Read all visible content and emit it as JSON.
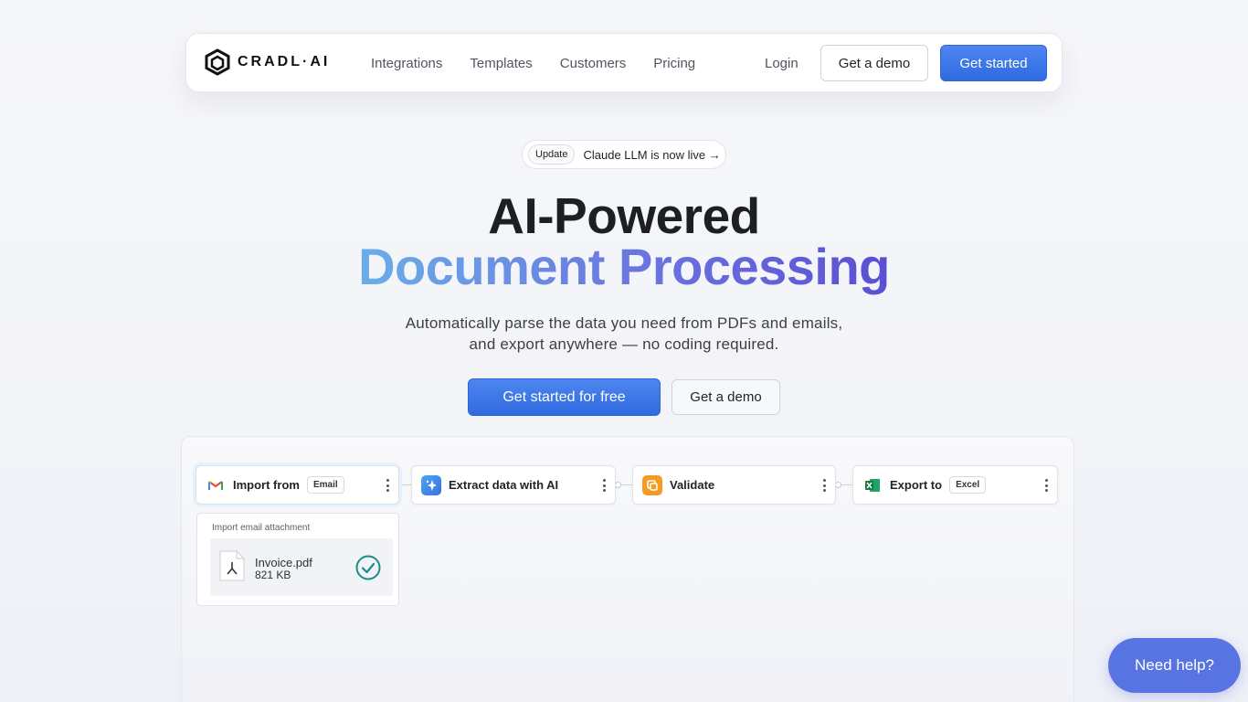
{
  "nav": {
    "logo_text": "CRADL·AI",
    "links": [
      "Integrations",
      "Templates",
      "Customers",
      "Pricing"
    ],
    "login": "Login",
    "demo": "Get a demo",
    "start": "Get started"
  },
  "update": {
    "pill": "Update",
    "text": "Claude LLM is now live →"
  },
  "hero": {
    "line1": "AI-Powered",
    "line2": "Document Processing",
    "sub1": "Automatically parse the data you need from PDFs and emails,",
    "sub2": "and export anywhere — no coding required.",
    "cta_primary": "Get started for free",
    "cta_secondary": "Get a demo"
  },
  "workflow": {
    "nodes": [
      {
        "title": "Import from",
        "chip": "Email",
        "icon": "gmail-icon"
      },
      {
        "title": "Extract data with AI",
        "chip": "",
        "icon": "ai-sparkle-icon"
      },
      {
        "title": "Validate",
        "chip": "",
        "icon": "validate-icon"
      },
      {
        "title": "Export to",
        "chip": "Excel",
        "icon": "excel-icon"
      }
    ],
    "attachment": {
      "label": "Import email attachment",
      "file_name": "Invoice.pdf",
      "file_size": "821 KB"
    }
  },
  "help": "Need help?",
  "colors": {
    "primary": "#2f6ae0",
    "gradient_start": "#6aaee8",
    "gradient_end": "#5b4fd3",
    "help_bg": "#5874e3",
    "check": "#1d8a8a"
  }
}
